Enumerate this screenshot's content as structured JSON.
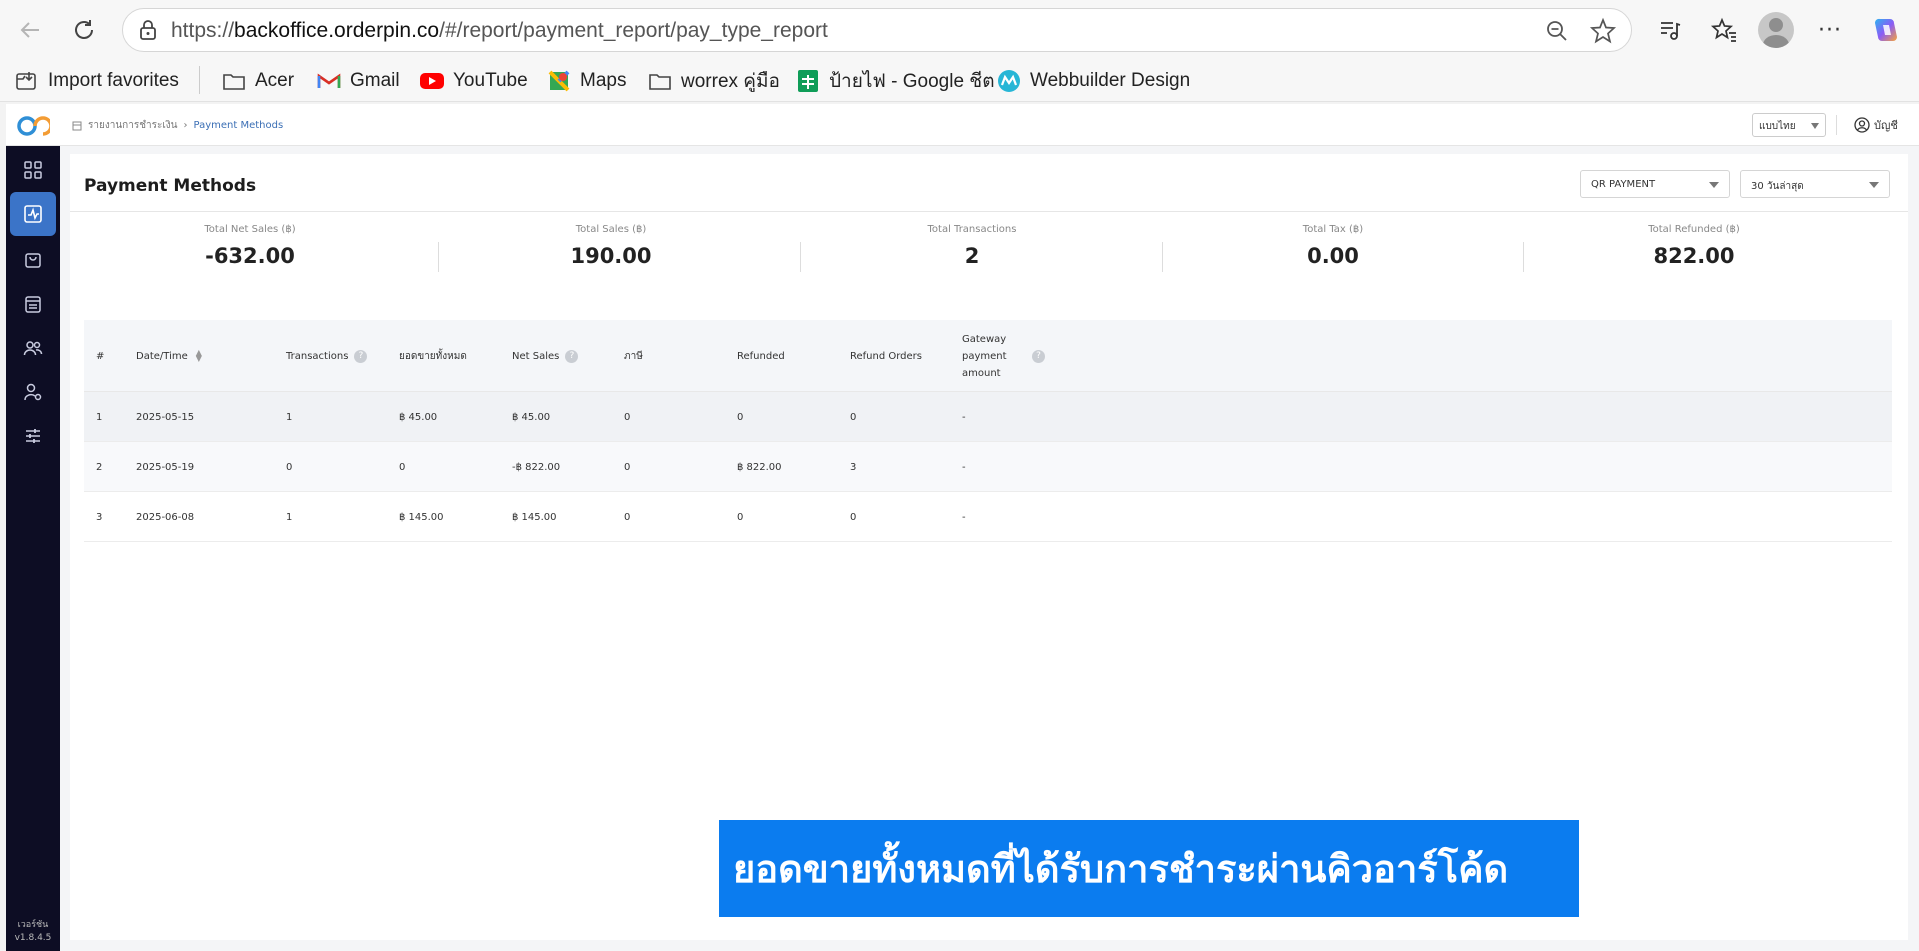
{
  "browser": {
    "url_prefix": "https://",
    "url_domain": "backoffice.orderpin.co",
    "url_path": "/#/report/payment_report/pay_type_report",
    "bookmarks": [
      {
        "label": "Import favorites",
        "icon": "import-icon"
      },
      {
        "label": "Acer",
        "icon": "folder-icon"
      },
      {
        "label": "Gmail",
        "icon": "gmail-icon"
      },
      {
        "label": "YouTube",
        "icon": "youtube-icon"
      },
      {
        "label": "Maps",
        "icon": "maps-icon"
      },
      {
        "label": "worrex คู่มือ",
        "icon": "folder-icon"
      },
      {
        "label": "ป้ายไฟ - Google ชีต",
        "icon": "sheets-icon"
      },
      {
        "label": "Webbuilder Design",
        "icon": "webbuilder-icon"
      }
    ]
  },
  "header": {
    "breadcrumb_parent": "รายงานการชำระเงิน",
    "breadcrumb_current": "Payment Methods",
    "language": "แบบไทย",
    "account": "บัญชี"
  },
  "sidebar": {
    "items": [
      {
        "icon": "dashboard-grid-icon",
        "active": false
      },
      {
        "icon": "report-chart-icon",
        "active": true
      },
      {
        "icon": "shopping-bag-icon",
        "active": false
      },
      {
        "icon": "inventory-icon",
        "active": false
      },
      {
        "icon": "customers-icon",
        "active": false
      },
      {
        "icon": "staff-settings-icon",
        "active": false
      },
      {
        "icon": "sliders-icon",
        "active": false
      }
    ],
    "version_label": "เวอร์ชัน",
    "version": "v1.8.4.5"
  },
  "page": {
    "title": "Payment Methods",
    "payment_filter": "QR PAYMENT",
    "date_filter": "30 วันล่าสุด"
  },
  "stats": [
    {
      "label": "Total Net Sales (฿)",
      "value": "-632.00"
    },
    {
      "label": "Total Sales (฿)",
      "value": "190.00"
    },
    {
      "label": "Total Transactions",
      "value": "2"
    },
    {
      "label": "Total Tax (฿)",
      "value": "0.00"
    },
    {
      "label": "Total Refunded (฿)",
      "value": "822.00"
    }
  ],
  "table": {
    "columns": [
      "#",
      "Date/Time",
      "Transactions",
      "ยอดขายทั้งหมด",
      "Net Sales",
      "ภาษี",
      "Refunded",
      "Refund Orders",
      "Gateway payment amount"
    ],
    "rows": [
      [
        "1",
        "2025-05-15",
        "1",
        "฿ 45.00",
        "฿ 45.00",
        "0",
        "0",
        "0",
        "-"
      ],
      [
        "2",
        "2025-05-19",
        "0",
        "0",
        "-฿ 822.00",
        "0",
        "฿ 822.00",
        "3",
        "-"
      ],
      [
        "3",
        "2025-06-08",
        "1",
        "฿ 145.00",
        "฿ 145.00",
        "0",
        "0",
        "0",
        "-"
      ]
    ]
  },
  "caption": "ยอดขายทั้งหมดที่ได้รับการชำระผ่านคิวอาร์โค้ด",
  "colors": {
    "sidebar_bg": "#0d0d24",
    "active_accent": "#3b74c8",
    "caption_bg": "#0b7cef"
  }
}
